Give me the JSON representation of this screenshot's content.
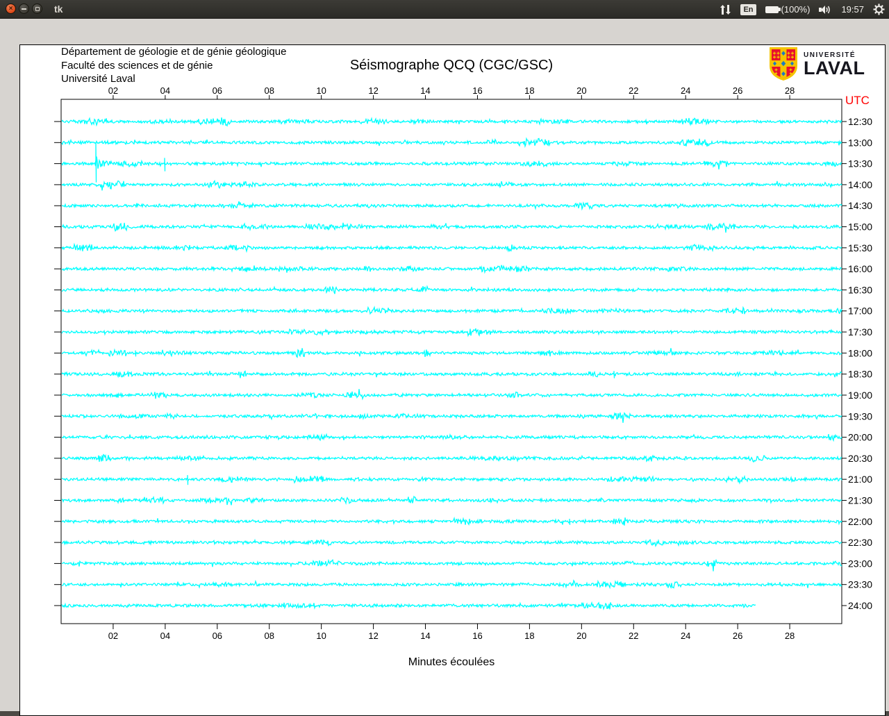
{
  "panel": {
    "window_title": "tk",
    "keyboard_layout": "En",
    "battery_label": "(100%)",
    "clock": "19:57"
  },
  "header": {
    "department": "Département de géologie et de génie géologique",
    "faculty": "Faculté des sciences et de génie",
    "university": "Université Laval"
  },
  "logo": {
    "small_text": "UNIVERSITÉ",
    "large_text": "LAVAL"
  },
  "chart_data": {
    "type": "line",
    "title": "Séismographe QCQ (CGC/GSC)",
    "xlabel": "Minutes écoulées",
    "right_axis_title": "UTC",
    "right_axis_color": "#ff0000",
    "trace_color": "#00ffff",
    "minutes_per_line": 30,
    "x_tick_labels": [
      "02",
      "04",
      "06",
      "08",
      "10",
      "12",
      "14",
      "16",
      "18",
      "20",
      "22",
      "24",
      "26",
      "28"
    ],
    "rows": [
      "12:30",
      "13:00",
      "13:30",
      "14:00",
      "14:30",
      "15:00",
      "15:30",
      "16:00",
      "16:30",
      "17:00",
      "17:30",
      "18:00",
      "18:30",
      "19:00",
      "19:30",
      "20:00",
      "20:30",
      "21:00",
      "21:30",
      "22:00",
      "22:30",
      "23:00",
      "23:30",
      "24:00"
    ],
    "last_trace_end_minute": 26.7,
    "events": [
      {
        "utc": "13:30",
        "minute": 1.33,
        "kind": "large-spike",
        "amplitude": 29,
        "coda_minutes": 2.4
      },
      {
        "utc": "13:30",
        "minute": 2.2,
        "kind": "burst",
        "amplitude": 5,
        "duration_min": 0.9
      },
      {
        "utc": "13:30",
        "minute": 3.97,
        "kind": "spike",
        "amplitude": 11
      },
      {
        "utc": "13:30",
        "minute": 29.35,
        "kind": "burst",
        "amplitude": 6,
        "duration_min": 0.5
      },
      {
        "utc": "17:00",
        "minute": 1.6,
        "kind": "burst",
        "amplitude": 3.5,
        "duration_min": 0.3
      },
      {
        "utc": "16:00",
        "minute": 6.8,
        "kind": "burst",
        "amplitude": 4,
        "duration_min": 0.3
      },
      {
        "utc": "18:00",
        "minute": 2.85,
        "kind": "spike",
        "amplitude": 5
      },
      {
        "utc": "18:30",
        "minute": 21.25,
        "kind": "spike",
        "amplitude": 6
      },
      {
        "utc": "19:00",
        "minute": 3.6,
        "kind": "burst",
        "amplitude": 6,
        "duration_min": 0.45
      },
      {
        "utc": "19:30",
        "minute": 19.85,
        "kind": "burst",
        "amplitude": 4,
        "duration_min": 0.3
      },
      {
        "utc": "21:00",
        "minute": 4.85,
        "kind": "spike",
        "amplitude": 8
      },
      {
        "utc": "22:00",
        "minute": 19.55,
        "kind": "spike",
        "amplitude": 5
      },
      {
        "utc": "23:00",
        "minute": 0.35,
        "kind": "burst",
        "amplitude": 5,
        "duration_min": 0.4
      }
    ]
  }
}
